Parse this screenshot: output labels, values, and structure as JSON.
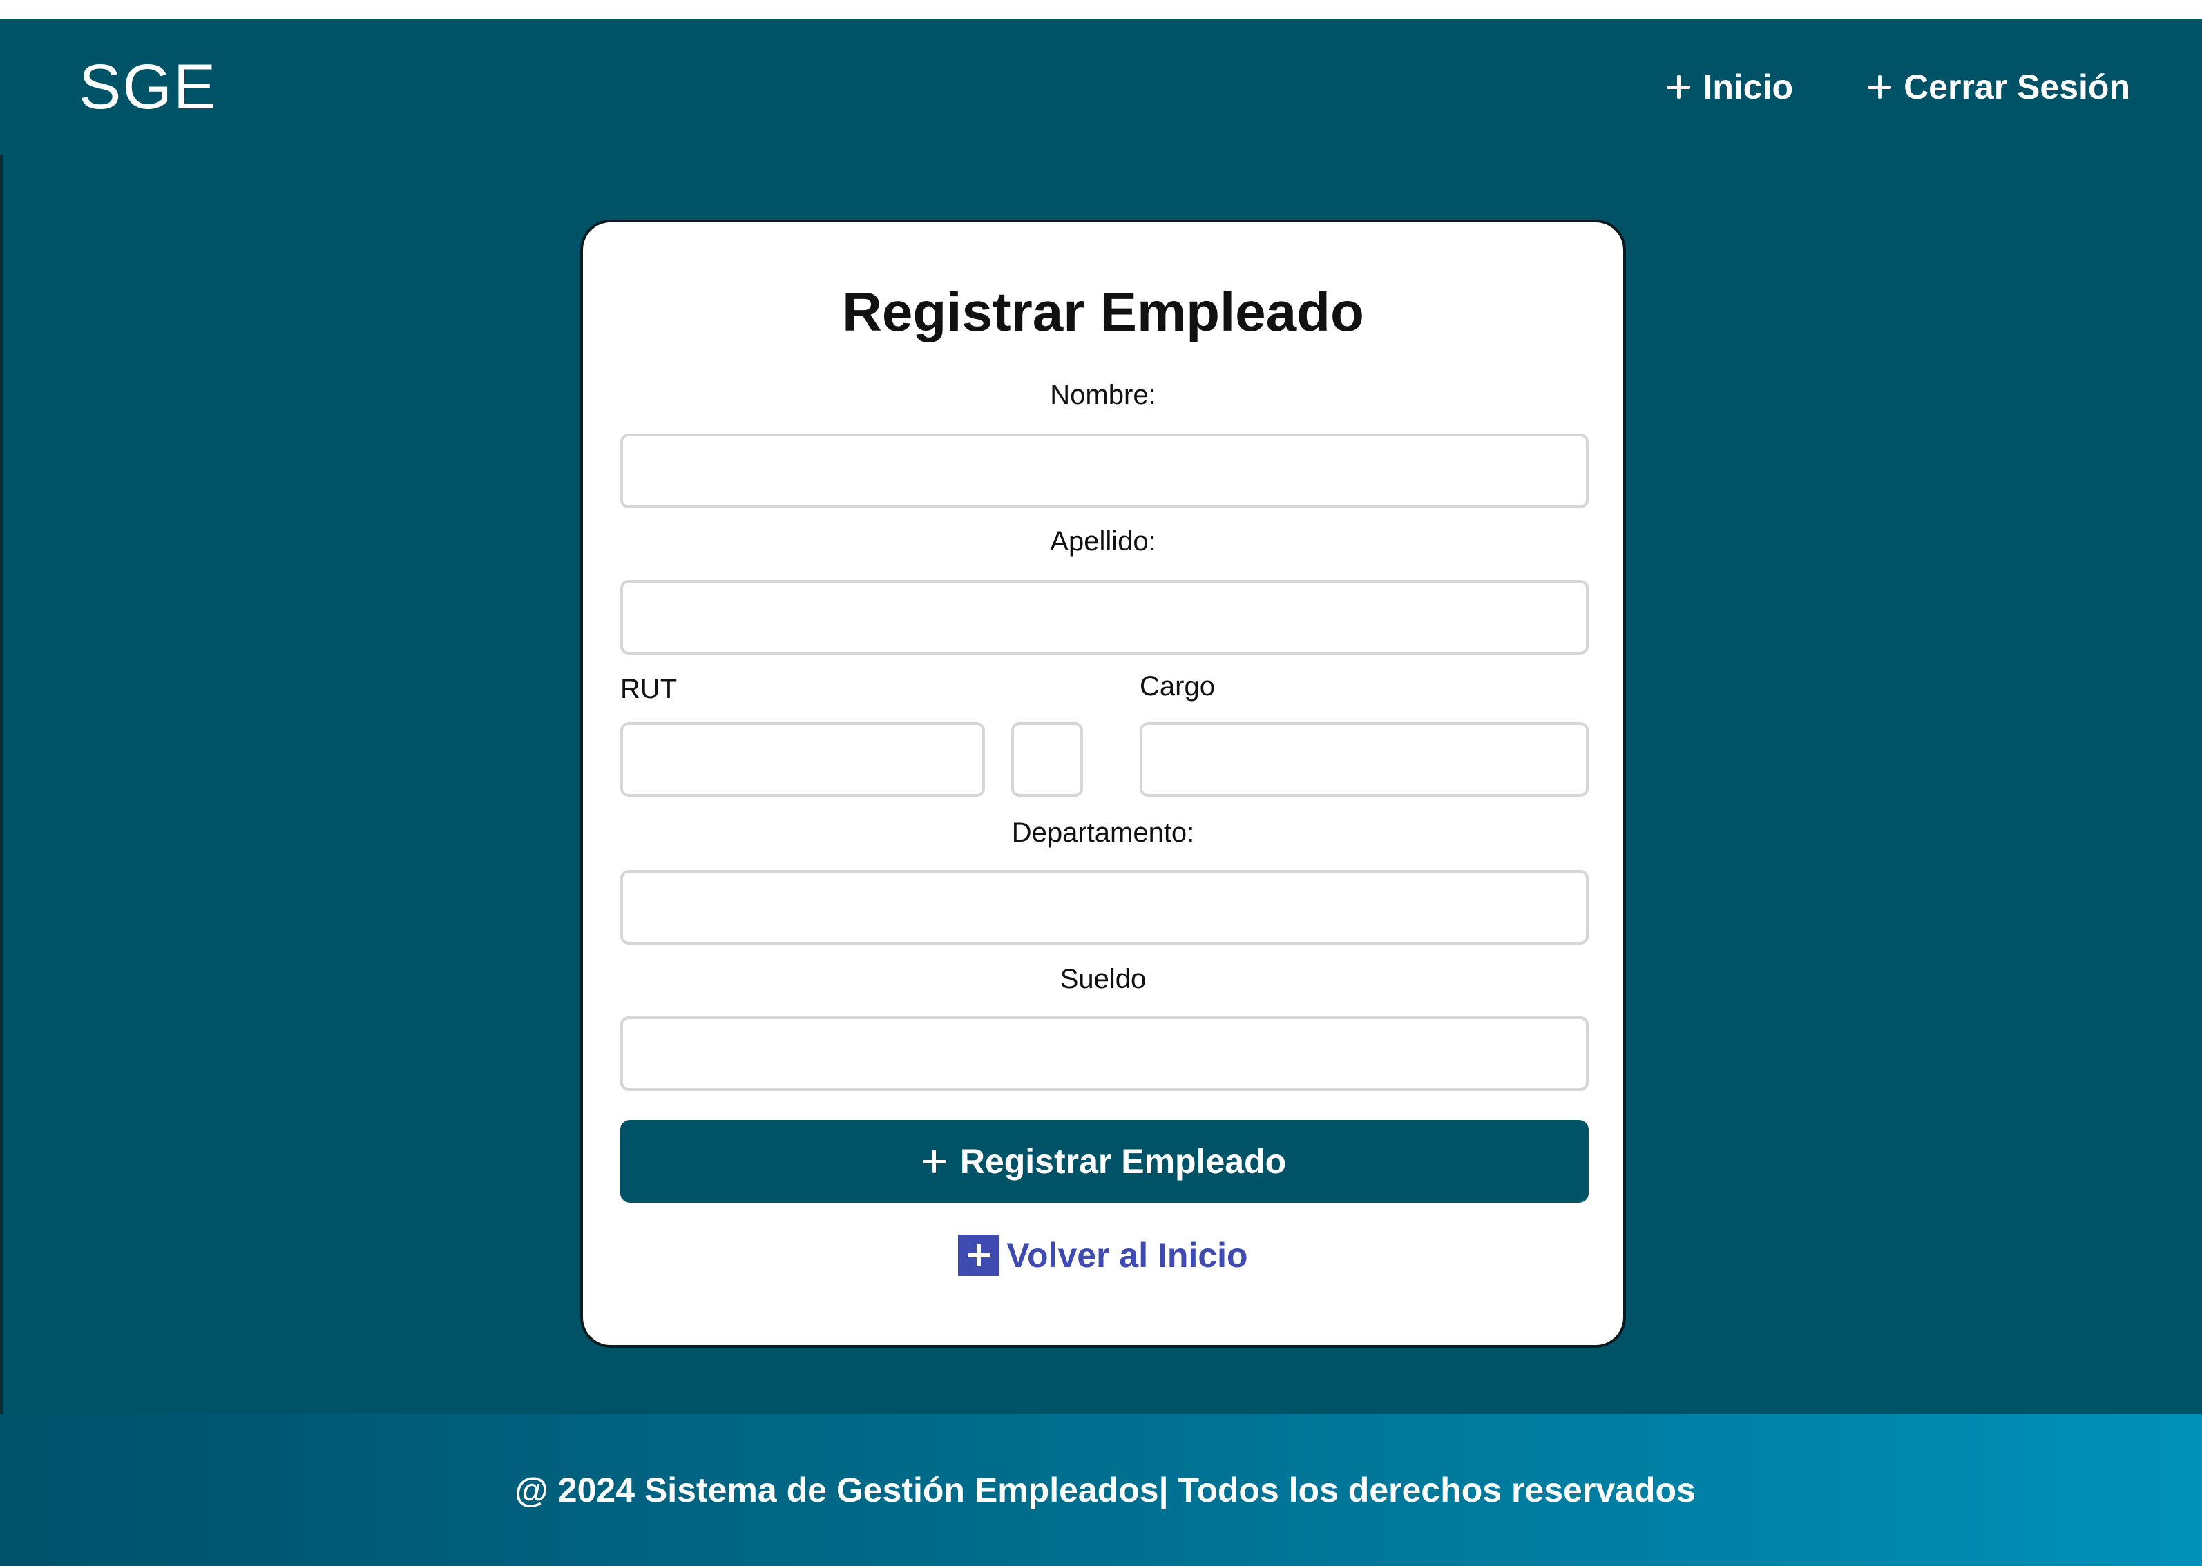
{
  "app": {
    "brand": "SGE"
  },
  "nav": {
    "items": [
      {
        "label": "Inicio",
        "icon": "plus-icon"
      },
      {
        "label": "Cerrar Sesión",
        "icon": "plus-icon"
      }
    ]
  },
  "form": {
    "title": "Registrar Empleado",
    "labels": {
      "nombre": "Nombre:",
      "apellido": "Apellido:",
      "rut": "RUT",
      "cargo": "Cargo",
      "departamento": "Departamento:",
      "sueldo": "Sueldo"
    },
    "values": {
      "nombre": "",
      "apellido": "",
      "rut": "",
      "rut_dv": "",
      "cargo": "",
      "departamento": "",
      "sueldo": ""
    },
    "submit_label": "Registrar Empleado",
    "back_label": "Volver al Inicio"
  },
  "footer": {
    "text": "@ 2024 Sistema de Gestión Empleados| Todos los derechos reservados"
  },
  "colors": {
    "primary": "#005267",
    "link": "#3f4bb0",
    "input_border": "#d6d6d6"
  }
}
